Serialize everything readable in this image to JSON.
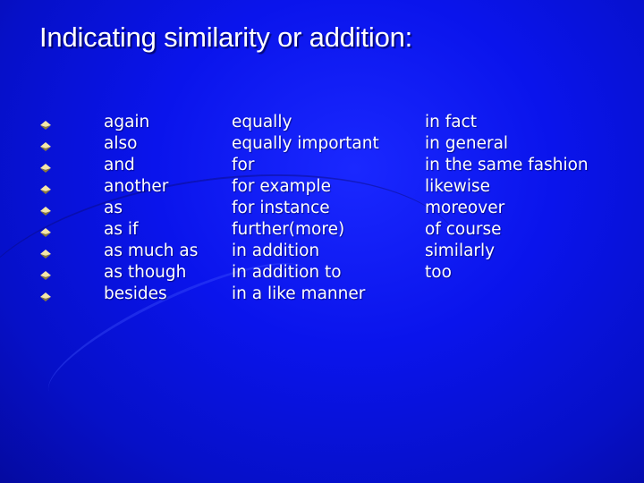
{
  "slide": {
    "title": "Indicating similarity or addition:",
    "bullet_icon": "gold-diamond-bullet-icon",
    "colors": {
      "background": "#0a14ec",
      "text": "#ffffff",
      "bullet": "#e8d48a"
    },
    "columns": [
      {
        "items": [
          "again",
          "also",
          "and",
          "another",
          "as",
          "as if",
          "as much as",
          "as though",
          "besides"
        ]
      },
      {
        "items": [
          "equally",
          "equally important",
          "for",
          "for example",
          "for instance",
          "further(more)",
          "in addition",
          "in addition to",
          "in a like manner"
        ]
      },
      {
        "items": [
          "in fact",
          "in general",
          "in the same fashion",
          "likewise",
          "moreover",
          "of course",
          "similarly",
          "too"
        ]
      }
    ]
  }
}
